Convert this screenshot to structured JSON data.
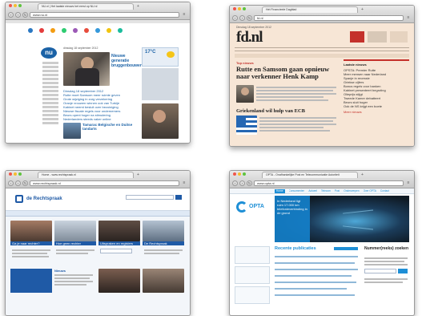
{
  "windows": [
    {
      "id": "nu",
      "tab_title": "NU.nl | Het laatste nieuws het eerst op NU.nl",
      "url": "www.nu.nl",
      "logo": "nu",
      "date": "dinsdag 18 september 2012",
      "hero_headline": "Nieuwe generatie bruggenbouwers",
      "headlines": [
        "Dinsdag 18 september 2012",
        "Rutte moet Samsom meer ruimte geven",
        "Grote wijziging in zorg verzekering",
        "Oranje vrouwen winnen ook van Turkije",
        "Kabinet neemt besluit over bezuiniging",
        "Nieuwe fiscale regels voor ondernemers",
        "Beurs opent hoger na stimulering",
        "Nederlanders steeds vaker online"
      ],
      "story_headline": "Tamarac Belgische en Duitse tandarts",
      "weather": "17°C",
      "colors": {
        "accent": "#1b62a6",
        "nav": "#3a3a3a"
      }
    },
    {
      "id": "fd",
      "tab_title": "Het Financieele Dagblad",
      "url": "fd.nl",
      "logo": "fd.nl",
      "date": "Dinsdag 18 september 2012",
      "section_left": "Top nieuws",
      "section_right": "Laatste nieuws",
      "headline": "Rutte en Samsom gaan opnieuw naar verkenner Henk Kamp",
      "subhead": "Griekenland wil hulp van ECB",
      "latest": [
        "OPSTA: Premier Rutte",
        "Meer mensen naar Nederland",
        "Spanje in recessie",
        "Griekse cijfers",
        "Bonus regels voor banken",
        "Kabinet presenteert begroting",
        "Olieprijs stijgt",
        "Tweede Kamer debatteert",
        "Beurs sluit hoger",
        "Ook de NS krijgt een boete"
      ],
      "more": "Meer nieuws",
      "colors": {
        "background": "#f7e6d6",
        "accent": "#c4312b"
      }
    },
    {
      "id": "rechtspraak",
      "tab_title": "Home - www.rechtspraak.nl",
      "url": "www.rechtspraak.nl",
      "logo": "de Rechtspraak",
      "cards": [
        "Ga je naar rechter?",
        "Hoe geen rechter",
        "Uitspraken en registers",
        "De Rechtspraak"
      ],
      "news_title": "Nieuws",
      "colors": {
        "accent": "#1f5aa6",
        "light": "#dfe9f5"
      }
    },
    {
      "id": "opta",
      "tab_title": "OPTA - Onafhankelijke Post en Telecommunicatie Autoriteit",
      "url": "www.opta.nl",
      "logo": "OPTA",
      "nav": [
        "Home",
        "Consumenten",
        "Actueel",
        "Telecom",
        "Post",
        "Onderwerpen",
        "Over OPTA",
        "Contact"
      ],
      "hero_text": "In Nederland ligt ruim 17.000 km telefonieverbinding in de grond",
      "recent_title": "Recente publicaties",
      "sidebar_title": "Nummer(reeks) zoeken",
      "colors": {
        "accent": "#1e8fd6",
        "dark": "#1c2630"
      }
    }
  ]
}
